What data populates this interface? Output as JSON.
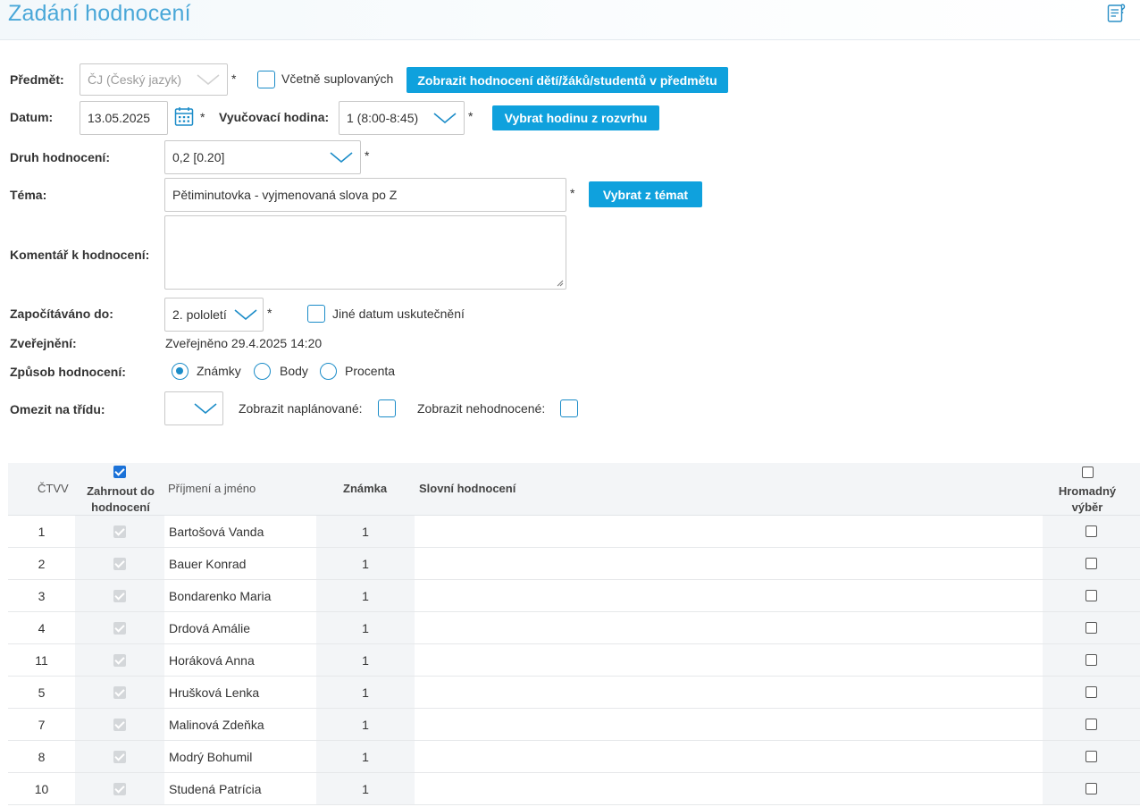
{
  "header": {
    "title": "Zadání hodnocení",
    "help_icon": "help-document-icon"
  },
  "form": {
    "subject": {
      "label": "Předmět:",
      "value": "ČJ (Český jazyk)",
      "required": "*"
    },
    "include_substitutions": {
      "label": "Včetně suplovaných",
      "checked": false
    },
    "show_grades_button": "Zobrazit hodnocení dětí/žáků/studentů v předmětu",
    "date": {
      "label": "Datum:",
      "value": "13.05.2025",
      "required": "*"
    },
    "lesson": {
      "label": "Vyučovací hodina:",
      "value": "1 (8:00-8:45)",
      "required": "*"
    },
    "pick_lesson_button": "Vybrat hodinu z rozvrhu",
    "grade_type": {
      "label": "Druh hodnocení:",
      "value": "0,2 [0.20]",
      "required": "*"
    },
    "topic": {
      "label": "Téma:",
      "value": "Pětiminutovka - vyjmenovaná slova po Z",
      "required": "*"
    },
    "pick_topic_button": "Vybrat z témat",
    "comment": {
      "label": "Komentář k hodnocení:",
      "value": ""
    },
    "counted_until": {
      "label": "Započítáváno do:",
      "value": "2. pololetí",
      "required": "*"
    },
    "other_date": {
      "label": "Jiné datum uskutečnění",
      "checked": false
    },
    "publication": {
      "label": "Zveřejnění:",
      "value": "Zveřejněno 29.4.2025 14:20"
    },
    "grading_method": {
      "label": "Způsob hodnocení:",
      "options": [
        "Známky",
        "Body",
        "Procenta"
      ],
      "selected": "Známky"
    },
    "limit_class": {
      "label": "Omezit na třídu:",
      "value": ""
    },
    "show_planned": {
      "label": "Zobrazit naplánované:",
      "checked": false
    },
    "show_ungraded": {
      "label": "Zobrazit nehodnocené:",
      "checked": false
    }
  },
  "table": {
    "headers": {
      "number": "ČTVV",
      "include": "Zahrnout do hodnocení",
      "name": "Příjmení a jméno",
      "grade": "Známka",
      "verbal": "Slovní hodnocení",
      "bulk": "Hromadný výběr"
    },
    "rows": [
      {
        "num": "1",
        "name": "Bartošová Vanda",
        "grade": "1"
      },
      {
        "num": "2",
        "name": "Bauer Konrad",
        "grade": "1"
      },
      {
        "num": "3",
        "name": "Bondarenko Maria",
        "grade": "1"
      },
      {
        "num": "4",
        "name": "Drdová Amálie",
        "grade": "1"
      },
      {
        "num": "11",
        "name": "Horáková Anna",
        "grade": "1"
      },
      {
        "num": "5",
        "name": "Hrušková Lenka",
        "grade": "1"
      },
      {
        "num": "7",
        "name": "Malinová Zdeňka",
        "grade": "1"
      },
      {
        "num": "8",
        "name": "Modrý Bohumil",
        "grade": "1"
      },
      {
        "num": "10",
        "name": "Studená Patrícia",
        "grade": "1"
      }
    ]
  },
  "colors": {
    "accent": "#0fa1dd",
    "title": "#49a7d8",
    "checkbox_border": "#1b8cc8"
  }
}
